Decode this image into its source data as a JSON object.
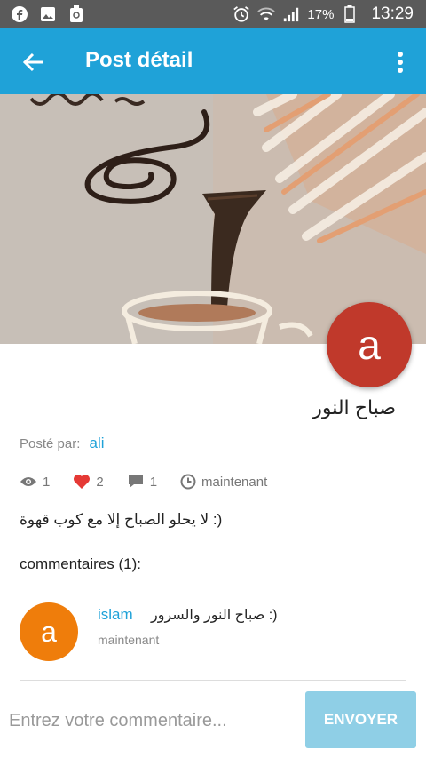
{
  "status_bar": {
    "battery": "17%",
    "time": "13:29"
  },
  "app_bar": {
    "title": "Post détail"
  },
  "post": {
    "avatar_letter": "a",
    "title": "صباح النور",
    "posted_by_label": "Posté par:",
    "author": "ali",
    "views": "1",
    "likes": "2",
    "comments_count": "1",
    "time": "maintenant",
    "body": "لا يحلو الصباح إلا مع كوب قهوة :)"
  },
  "comments": {
    "header": "commentaires (1):",
    "items": [
      {
        "avatar_letter": "a",
        "author": "islam",
        "text": "صباح النور والسرور :)",
        "time": "maintenant"
      }
    ]
  },
  "input": {
    "placeholder": "Entrez votre commentaire...",
    "send_label": "ENVOYER"
  },
  "colors": {
    "primary": "#1fa2d8",
    "avatar_post": "#c0392b",
    "avatar_comment": "#ef7d0b",
    "like": "#e53935"
  }
}
